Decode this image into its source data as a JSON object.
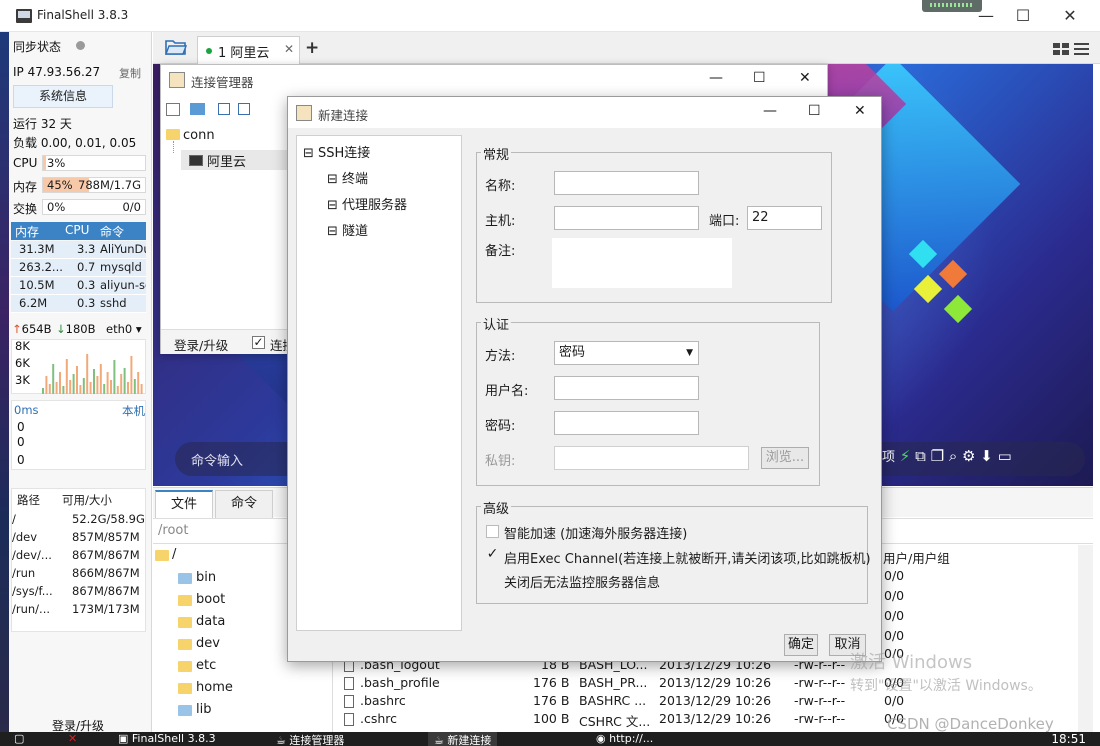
{
  "window": {
    "title": "FinalShell 3.8.3",
    "minimize": "—",
    "maximize": "☐",
    "close": "✕"
  },
  "left_panel": {
    "sync_status": "同步状态",
    "ip": "IP 47.93.56.27",
    "copy": "复制",
    "system_info": "系统信息",
    "uptime": "运行 32 天",
    "load": "负载 0.00, 0.01, 0.05",
    "cpu": {
      "label": "CPU",
      "value": "3%",
      "percent": 3
    },
    "mem": {
      "label": "内存",
      "value": "45%",
      "detail": "788M/1.7G",
      "percent": 45
    },
    "swap": {
      "label": "交换",
      "value": "0%",
      "detail": "0/0",
      "percent": 0
    },
    "proc_headers": {
      "mem": "内存",
      "cpu": "CPU",
      "cmd": "命令"
    },
    "processes": [
      {
        "mem": "31.3M",
        "cpu": "3.3",
        "cmd": "AliYunDu"
      },
      {
        "mem": "263.2...",
        "cpu": "0.7",
        "cmd": "mysqld"
      },
      {
        "mem": "10.5M",
        "cpu": "0.3",
        "cmd": "aliyun-se"
      },
      {
        "mem": "6.2M",
        "cpu": "0.3",
        "cmd": "sshd"
      }
    ],
    "net": {
      "up": "654B",
      "down": "180B",
      "iface": "eth0"
    },
    "net_scale": [
      "8K",
      "6K",
      "3K"
    ],
    "ping": {
      "latency": "0ms",
      "host": "本机",
      "values": [
        "0",
        "0",
        "0"
      ]
    },
    "disk_headers": {
      "path": "路径",
      "avail": "可用/大小"
    },
    "disks": [
      {
        "path": "/",
        "size": "52.2G/58.9G"
      },
      {
        "path": "/dev",
        "size": "857M/857M"
      },
      {
        "path": "/dev/...",
        "size": "867M/867M"
      },
      {
        "path": "/run",
        "size": "866M/867M"
      },
      {
        "path": "/sys/f...",
        "size": "867M/867M"
      },
      {
        "path": "/run/...",
        "size": "173M/173M"
      }
    ],
    "login_upgrade": "登录/升级"
  },
  "tabs": {
    "session": "1 阿里云",
    "close": "✕",
    "add": "+"
  },
  "terminal": {
    "command_input": "命令输入",
    "toolbar_partial": "项"
  },
  "files": {
    "tab_files": "文件",
    "tab_cmd": "命令",
    "path": "/root",
    "tree": [
      "/",
      "bin",
      "boot",
      "data",
      "dev",
      "etc",
      "home",
      "lib"
    ],
    "owner_header": "用户/用户组",
    "owners": [
      "0/0",
      "0/0",
      "0/0",
      "0/0",
      "0/0"
    ],
    "rows": [
      {
        "name": ".bash_logout",
        "size": "18 B",
        "type": "BASH_LO...",
        "date": "2013/12/29 10:26",
        "perm": "-rw-r--r--",
        "owner": "0/0"
      },
      {
        "name": ".bash_profile",
        "size": "176 B",
        "type": "BASH_PR...",
        "date": "2013/12/29 10:26",
        "perm": "-rw-r--r--",
        "owner": "0/0"
      },
      {
        "name": ".bashrc",
        "size": "176 B",
        "type": "BASHRC ...",
        "date": "2013/12/29 10:26",
        "perm": "-rw-r--r--",
        "owner": "0/0"
      },
      {
        "name": ".cshrc",
        "size": "100 B",
        "type": "CSHRC 文...",
        "date": "2013/12/29 10:26",
        "perm": "-rw-r--r--",
        "owner": "0/0"
      }
    ]
  },
  "conn_manager": {
    "title": "连接管理器",
    "folder": "conn",
    "server": "阿里云",
    "login_upgrade": "登录/升级",
    "connect_partial": "连接"
  },
  "new_conn": {
    "title": "新建连接",
    "tree": {
      "root": "SSH连接",
      "terminal": "终端",
      "proxy": "代理服务器",
      "tunnel": "隧道"
    },
    "general": {
      "title": "常规",
      "name": "名称:",
      "host": "主机:",
      "port_label": "端口:",
      "port": "22",
      "note": "备注:"
    },
    "auth": {
      "title": "认证",
      "method": "方法:",
      "method_value": "密码",
      "username": "用户名:",
      "password": "密码:",
      "key": "私钥:",
      "browse": "浏览..."
    },
    "advanced": {
      "title": "高级",
      "accel": "智能加速 (加速海外服务器连接)",
      "exec": "启用Exec Channel(若连接上就被断开,请关闭该项,比如跳板机)",
      "exec_note": "关闭后无法监控服务器信息"
    },
    "ok": "确定",
    "cancel": "取消"
  },
  "overlay": {
    "activate": "激活 Windows",
    "activate_hint": "转到\"设置\"以激活 Windows。",
    "csdn": "CSDN @DanceDonkey"
  },
  "taskbar": {
    "finalshell": "FinalShell 3.8.3",
    "conn_mgr": "连接管理器",
    "new_conn": "新建连接",
    "http": "http://...",
    "time": "18:51"
  },
  "colors": {
    "accent": "#3c83c6",
    "meter": "#f7c9a8",
    "brand_bg": "#2c3a9c"
  }
}
